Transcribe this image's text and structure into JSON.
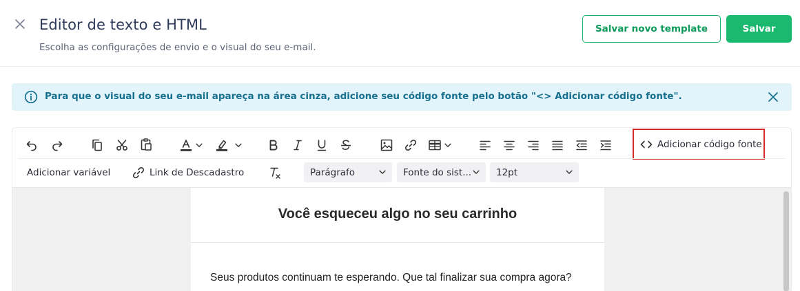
{
  "header": {
    "title": "Editor de texto e HTML",
    "subtitle": "Escolha as configurações de envio e o visual do seu e-mail.",
    "save_template_label": "Salvar novo template",
    "save_label": "Salvar"
  },
  "info_banner": {
    "text": "Para que o visual do seu e-mail apareça na área cinza, adicione seu código fonte pelo botão \"<> Adicionar código fonte\"."
  },
  "toolbar": {
    "source_code_label": "Adicionar código fonte",
    "add_variable_label": "Adicionar variável",
    "unsubscribe_link_label": "Link de Descadastro",
    "block_format": "Parágrafo",
    "font_family": "Fonte do sist...",
    "font_size": "12pt"
  },
  "email": {
    "heading": "Você esqueceu algo no seu carrinho",
    "body": "Seus produtos continuam te esperando. Que tal finalizar sua compra agora?"
  },
  "colors": {
    "brand_green": "#1ab96f",
    "info_bg": "#e2f4fa",
    "info_text": "#16708f",
    "highlight_border": "#d42a2a"
  }
}
